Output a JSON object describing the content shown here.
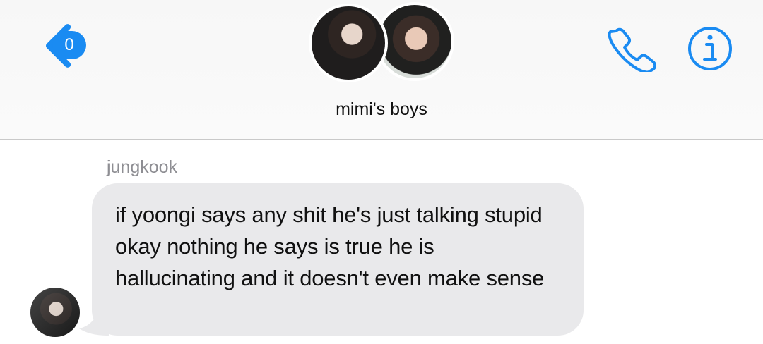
{
  "header": {
    "unread_count": "0",
    "group_name": "mimi's boys",
    "icons": {
      "back": "back-chevron-icon",
      "call": "phone-icon",
      "info": "info-icon"
    }
  },
  "conversation": {
    "sender": "jungkook",
    "message": "if yoongi says any shit he's just talking stupid okay nothing he says is true he is hallucinating and it doesn't even make sense"
  },
  "colors": {
    "accent": "#1a8bf2",
    "incoming_bubble": "#e9e9eb",
    "sender_name": "#8e8e93",
    "divider": "#c9c9c9"
  }
}
